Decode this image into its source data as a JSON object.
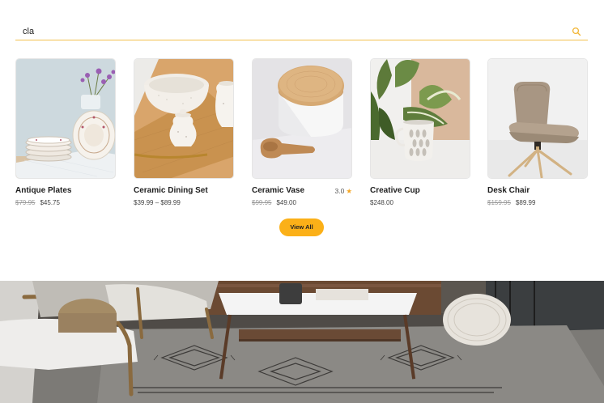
{
  "search": {
    "value": "cla",
    "placeholder": ""
  },
  "products": [
    {
      "name": "Antique Plates",
      "old_price": "$79.95",
      "price": "$45.75"
    },
    {
      "name": "Ceramic Dining Set",
      "price": "$39.99 – $89.99"
    },
    {
      "name": "Ceramic Vase",
      "old_price": "$99.95",
      "price": "$49.00",
      "rating": "3.0"
    },
    {
      "name": "Creative Cup",
      "price": "$248.00"
    },
    {
      "name": "Desk Chair",
      "old_price": "$159.95",
      "price": "$89.99"
    }
  ],
  "view_all_label": "View All",
  "colors": {
    "accent": "#fbb018",
    "search_underline": "#f2c14e",
    "star": "#f5a623"
  },
  "icons": [
    "search-icon",
    "star-icon"
  ]
}
